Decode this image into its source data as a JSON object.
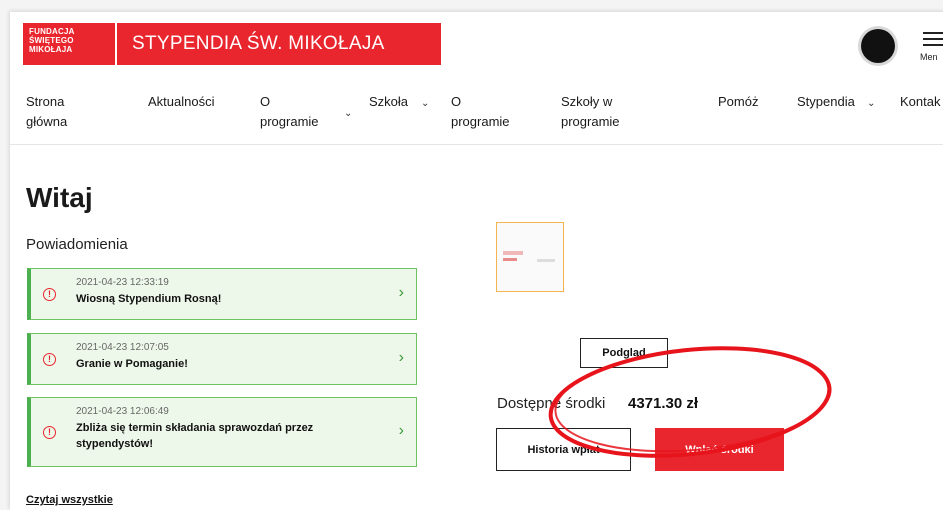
{
  "header": {
    "logo_lines": [
      "FUNDACJA",
      "ŚWIĘTEGO",
      "MIKOŁAJA"
    ],
    "brand_title": "STYPENDIA ŚW. MIKOŁAJA",
    "menu_label": "Men"
  },
  "nav": {
    "items": [
      {
        "line1": "Strona",
        "line2": "główna"
      },
      {
        "line1": "Aktualności",
        "line2": ""
      },
      {
        "line1": "O",
        "line2": "programie"
      },
      {
        "line1": "Szkoła",
        "line2": ""
      },
      {
        "line1": "O",
        "line2": "programie"
      },
      {
        "line1": "Szkoły w",
        "line2": "programie"
      },
      {
        "line1": "Pomóż",
        "line2": ""
      },
      {
        "line1": "Stypendia",
        "line2": ""
      },
      {
        "line1": "Kontak",
        "line2": ""
      }
    ]
  },
  "main": {
    "title": "Witaj",
    "notifications_heading": "Powiadomienia",
    "notifications": [
      {
        "date": "2021-04-23 12:33:19",
        "text_lines": [
          "Wiosną Stypendium Rosną!"
        ]
      },
      {
        "date": "2021-04-23 12:07:05",
        "text_lines": [
          "Granie w Pomaganie!"
        ]
      },
      {
        "date": "2021-04-23 12:06:49",
        "text_lines": [
          "Zbliża się termin składania sprawozdań przez",
          "stypendystów!"
        ]
      }
    ],
    "read_all": "Czytaj wszystkie"
  },
  "side": {
    "preview_button": "Podgląd",
    "funds_label": "Dostępne środki",
    "funds_value": "4371.30 zł",
    "history_button": "Historia wpłat",
    "pay_button": "Wpłać środki"
  },
  "colors": {
    "brand_red": "#e9262e",
    "notif_bg": "#eef8ea",
    "notif_border": "#4caf50",
    "annotation": "#e8141c"
  }
}
